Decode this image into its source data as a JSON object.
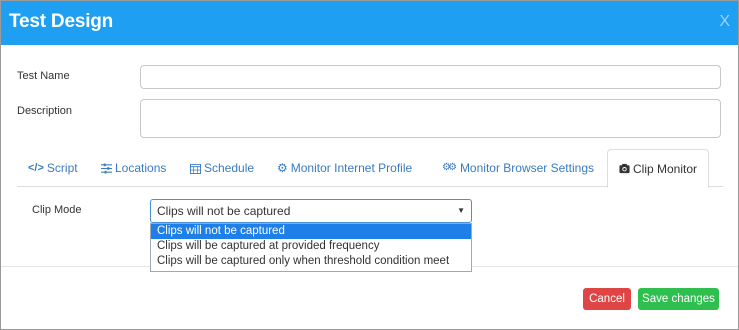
{
  "dialog": {
    "title": "Test Design",
    "close_label": "X"
  },
  "form": {
    "test_name_label": "Test Name",
    "test_name_value": "",
    "description_label": "Description",
    "description_value": ""
  },
  "tabs": [
    {
      "label": "Script",
      "icon": "code-icon",
      "active": false
    },
    {
      "label": "Locations",
      "icon": "sliders-icon",
      "active": false
    },
    {
      "label": "Schedule",
      "icon": "calendar-icon",
      "active": false
    },
    {
      "label": "Monitor Internet Profile",
      "icon": "gear-icon",
      "active": false
    },
    {
      "label": "Monitor Browser Settings",
      "icon": "gears-icon",
      "active": false
    },
    {
      "label": "Clip Monitor",
      "icon": "camera-icon",
      "active": true
    }
  ],
  "clip_mode": {
    "label": "Clip Mode",
    "selected": "Clips will not be captured",
    "options": [
      "Clips will not be captured",
      "Clips will be captured at provided frequency",
      "Clips will be captured only when threshold condition meet"
    ]
  },
  "footer": {
    "cancel_label": "Cancel",
    "save_label": "Save changes"
  },
  "colors": {
    "header": "#1e9ff2",
    "tab_link": "#3a7bbf",
    "cancel": "#e04545",
    "save": "#2fbf4f",
    "option_highlight": "#1e7fe8"
  }
}
